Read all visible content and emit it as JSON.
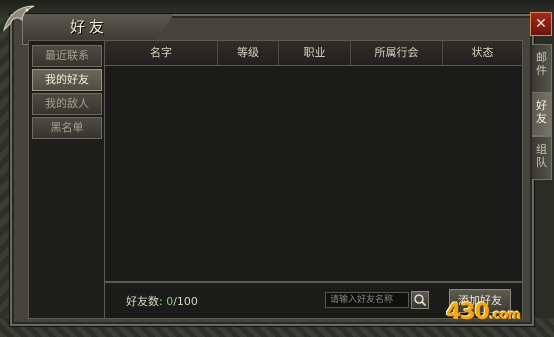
{
  "window": {
    "title": "好友"
  },
  "side_tabs": [
    {
      "label": "邮件"
    },
    {
      "label": "好友"
    },
    {
      "label": "组队"
    }
  ],
  "nav": [
    {
      "label": "最近联系"
    },
    {
      "label": "我的好友"
    },
    {
      "label": "我的敌人"
    },
    {
      "label": "黑名单"
    }
  ],
  "table": {
    "columns": [
      "名字",
      "等级",
      "职业",
      "所属行会",
      "状态"
    ]
  },
  "footer": {
    "count_label": "好友数:",
    "count_current": "0",
    "count_max": "/100",
    "search_placeholder": "请输入好友名称",
    "add_label": "添加好友"
  },
  "watermark": {
    "text": "430",
    "suffix": ".com"
  },
  "colors": {
    "count_green": "#6fd56a",
    "close_red": "#a32a20"
  }
}
